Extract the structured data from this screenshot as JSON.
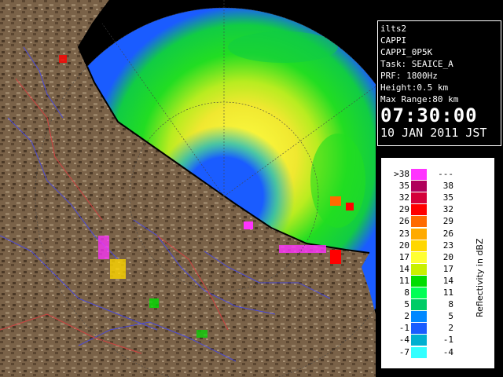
{
  "info": {
    "station": "ilts2",
    "product": "CAPPI",
    "product_id": "CAPPI_0P5K",
    "task": "Task: SEAICE_A",
    "prf": "PRF: 1800Hz",
    "height": "Height:0.5 km",
    "max_range": "Max Range:80 km",
    "time": "07:30:00",
    "date": "10 JAN 2011 JST"
  },
  "legend": {
    "title": "Reflectivity in dBZ",
    "rows": [
      {
        "lo": ">38",
        "hi": "---",
        "color": "#ff33ff"
      },
      {
        "lo": "35",
        "hi": "38",
        "color": "#b0005a"
      },
      {
        "lo": "32",
        "hi": "35",
        "color": "#d4003a"
      },
      {
        "lo": "29",
        "hi": "32",
        "color": "#ff0000"
      },
      {
        "lo": "26",
        "hi": "29",
        "color": "#ff6a00"
      },
      {
        "lo": "23",
        "hi": "26",
        "color": "#ffaa00"
      },
      {
        "lo": "20",
        "hi": "23",
        "color": "#ffd700"
      },
      {
        "lo": "17",
        "hi": "20",
        "color": "#ffff33"
      },
      {
        "lo": "14",
        "hi": "17",
        "color": "#c8f000"
      },
      {
        "lo": "11",
        "hi": "14",
        "color": "#00dd00"
      },
      {
        "lo": "8",
        "hi": "11",
        "color": "#00ff55"
      },
      {
        "lo": "5",
        "hi": "8",
        "color": "#00cc66"
      },
      {
        "lo": "2",
        "hi": "5",
        "color": "#0088ff"
      },
      {
        "lo": "-1",
        "hi": "2",
        "color": "#1a5cff"
      },
      {
        "lo": "-4",
        "hi": "-1",
        "color": "#00b0d0"
      },
      {
        "lo": "-7",
        "hi": "-4",
        "color": "#33ffff"
      }
    ]
  },
  "colors": {
    "land": "#7a6248",
    "coastline": "#000000",
    "rivers": "#4a4ad8",
    "boundaries": "#d04040",
    "range_ring": "#444444"
  }
}
